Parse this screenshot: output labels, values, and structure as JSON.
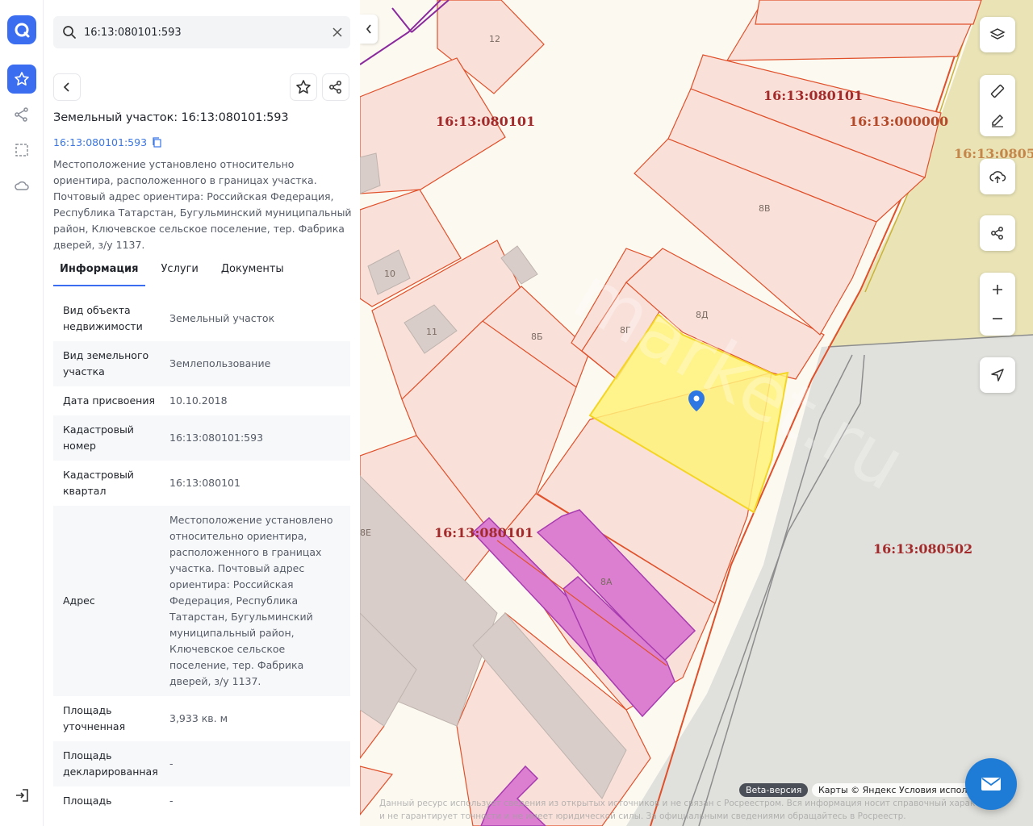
{
  "search": {
    "value": "16:13:080101:593",
    "placeholder": ""
  },
  "object": {
    "title": "Земельный участок: 16:13:080101:593",
    "cad_link": "16:13:080101:593",
    "description": "Местоположение установлено относительно ориентира, расположенного в границах участка. Почтовый адрес ориентира: Российская Федерация, Республика Татарстан, Бугульминский муниципальный район, Ключевское сельское поселение, тер. Фабрика дверей, з/у 1137."
  },
  "tabs": [
    {
      "label": "Информация"
    },
    {
      "label": "Услуги"
    },
    {
      "label": "Документы"
    }
  ],
  "rows": [
    {
      "key": "Вид объекта недвижимости",
      "value": "Земельный участок"
    },
    {
      "key": "Вид земельного участка",
      "value": "Землепользование"
    },
    {
      "key": "Дата присвоения",
      "value": "10.10.2018"
    },
    {
      "key": "Кадастровый номер",
      "value": "16:13:080101:593"
    },
    {
      "key": "Кадастровый квартал",
      "value": "16:13:080101"
    },
    {
      "key": "Адрес",
      "value": "Местоположение установлено относительно ориентира, расположенного в границах участка. Почтовый адрес ориентира: Российская Федерация, Республика Татарстан, Бугульминский муниципальный район, Ключевское сельское поселение, тер. Фабрика дверей, з/у 1137."
    },
    {
      "key": "Площадь уточненная",
      "value": "3,933 кв. м"
    },
    {
      "key": "Площадь декларированная",
      "value": "-"
    },
    {
      "key": "Площадь",
      "value": "-"
    }
  ],
  "map": {
    "cad_labels": [
      "16:13:080101",
      "16:13:080101",
      "16:13:000000",
      "16:13:0805",
      "16:13:080101",
      "16:13:080502"
    ],
    "plot_labels": [
      "12",
      "8В",
      "10",
      "11",
      "8Б",
      "8Г",
      "8Д",
      "8А",
      "8Е"
    ],
    "watermark": "market.ru",
    "beta": "Beta-версия",
    "attribution": "Карты © Яндекс  Условия испол",
    "disclaimer": "Данный ресурс использует сведения из открытых источников и не связан с Росреестром. Вся информация носит справочный характер и не гарантирует точности и не имеет юридической силы. За официальными сведениями обращайтесь в Росреестр."
  },
  "colors": {
    "accent": "#3a6df0",
    "parcel_line": "#e0502a",
    "selected": "#fff27a",
    "building": "#dd7fd0"
  },
  "icons": {
    "logo": "app-logo-icon",
    "rail": [
      "star-icon",
      "route-icon",
      "select-area-icon",
      "cloud-icon",
      "logout-icon"
    ]
  }
}
